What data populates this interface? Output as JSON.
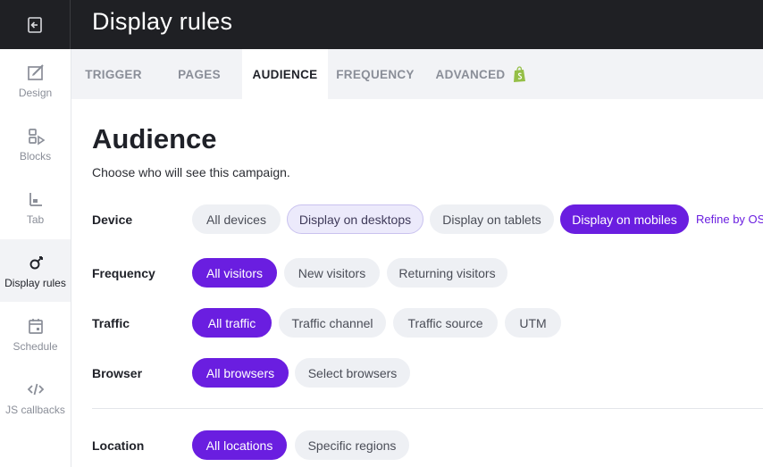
{
  "header": {
    "title": "Display rules"
  },
  "sidebar": {
    "items": [
      {
        "label": "Design",
        "icon": "design-icon"
      },
      {
        "label": "Blocks",
        "icon": "blocks-icon"
      },
      {
        "label": "Tab",
        "icon": "tab-icon"
      },
      {
        "label": "Display rules",
        "icon": "display-rules-icon",
        "active": true
      },
      {
        "label": "Schedule",
        "icon": "calendar-icon"
      },
      {
        "label": "JS callbacks",
        "icon": "code-icon"
      }
    ]
  },
  "tabs": [
    {
      "label": "TRIGGER"
    },
    {
      "label": "PAGES"
    },
    {
      "label": "AUDIENCE",
      "active": true
    },
    {
      "label": "FREQUENCY"
    },
    {
      "label": "ADVANCED",
      "icon": "shopify-icon"
    }
  ],
  "main": {
    "title": "Audience",
    "subtitle": "Choose who will see this campaign.",
    "device": {
      "label": "Device",
      "options": [
        "All devices",
        "Display on desktops",
        "Display on tablets",
        "Display on mobiles"
      ],
      "refine_link": "Refine by OS"
    },
    "frequency": {
      "label": "Frequency",
      "options": [
        "All visitors",
        "New visitors",
        "Returning visitors"
      ]
    },
    "traffic": {
      "label": "Traffic",
      "options": [
        "All traffic",
        "Traffic channel",
        "Traffic source",
        "UTM"
      ]
    },
    "browser": {
      "label": "Browser",
      "options": [
        "All browsers",
        "Select browsers"
      ]
    },
    "location": {
      "label": "Location",
      "options": [
        "All locations",
        "Specific regions"
      ]
    }
  },
  "colors": {
    "accent": "#6a1ee0",
    "header_bg": "#1f2024",
    "tabbar_bg": "#f2f3f6",
    "pill_bg": "#eef0f4"
  }
}
